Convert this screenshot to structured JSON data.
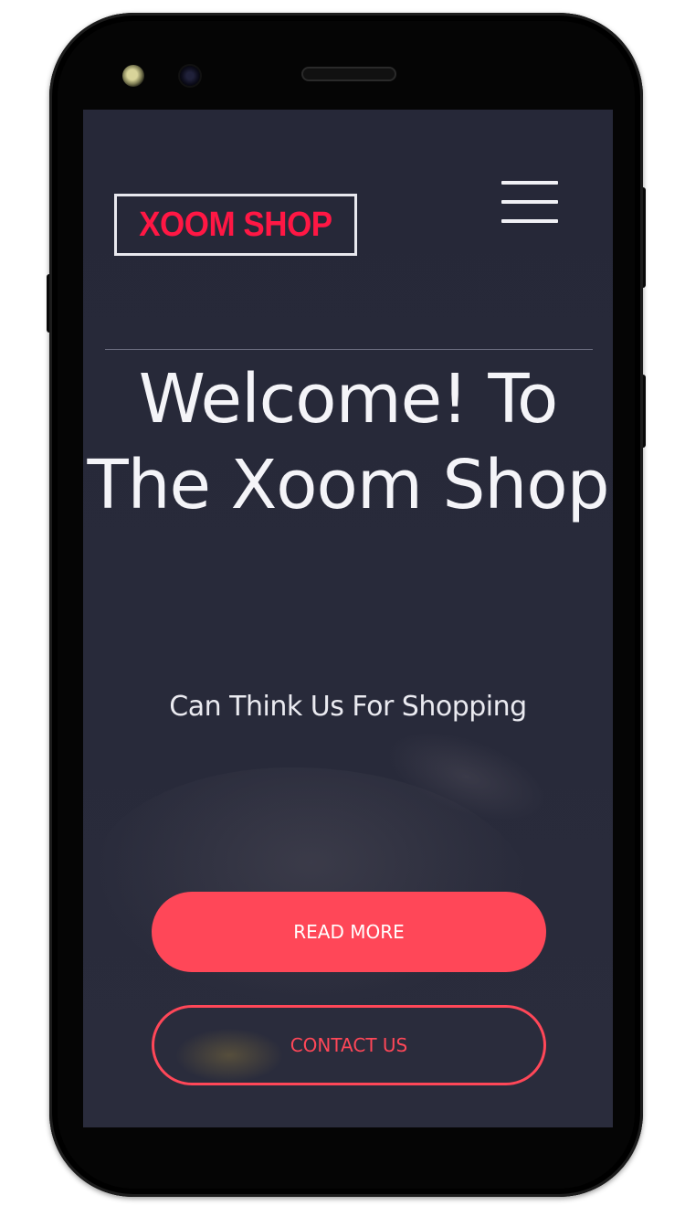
{
  "header": {
    "logo_text": "XOOM SHOP",
    "menu_icon": "hamburger-menu-icon"
  },
  "hero": {
    "title": "Welcome! To The Xoom Shop",
    "subtitle": "Can Think Us For Shopping"
  },
  "actions": {
    "read_more_label": "READ MORE",
    "contact_us_label": "CONTACT US"
  },
  "colors": {
    "accent": "#ff4758",
    "logo_text": "#ff1744",
    "background": "#282a3a",
    "text": "#f4f4f8"
  }
}
